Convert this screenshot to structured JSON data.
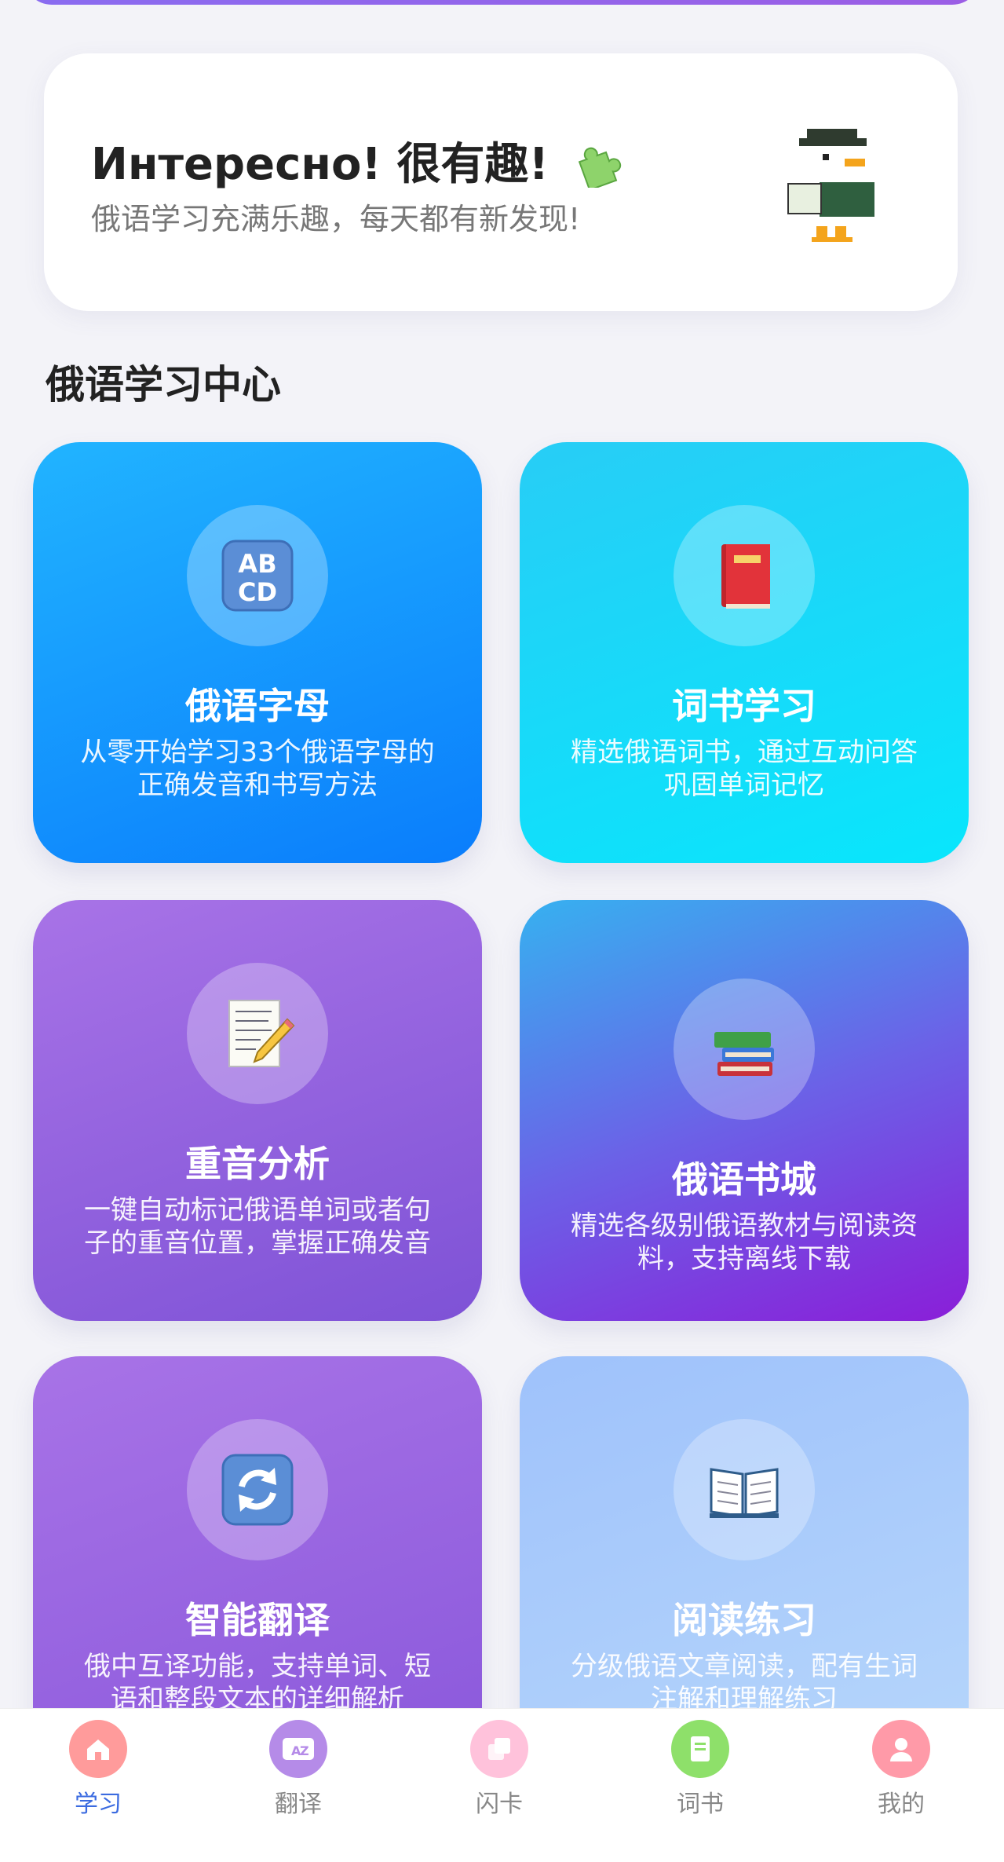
{
  "banner": {
    "title": "Интересно! 很有趣!",
    "subtitle": "俄语学习充满乐趣，每天都有新发现!"
  },
  "section": {
    "title": "俄语学习中心"
  },
  "cards": [
    {
      "title": "俄语字母",
      "desc": "从零开始学习33个俄语字母的正确发音和书写方法",
      "icon": "abcd-icon"
    },
    {
      "title": "词书学习",
      "desc": "精选俄语词书，通过互动问答巩固单词记忆",
      "icon": "red-book-icon"
    },
    {
      "title": "重音分析",
      "desc": "一键自动标记俄语单词或者句子的重音位置，掌握正确发音",
      "icon": "memo-pencil-icon"
    },
    {
      "title": "俄语书城",
      "desc": "精选各级别俄语教材与阅读资料，支持离线下载",
      "icon": "books-stack-icon"
    },
    {
      "title": "智能翻译",
      "desc": "俄中互译功能，支持单词、短语和整段文本的详细解析",
      "icon": "refresh-icon"
    },
    {
      "title": "阅读练习",
      "desc": "分级俄语文章阅读，配有生词注解和理解练习",
      "icon": "open-book-icon"
    }
  ],
  "tabs": [
    {
      "label": "学习",
      "icon": "home-icon",
      "active": true
    },
    {
      "label": "翻译",
      "icon": "translate-icon",
      "active": false
    },
    {
      "label": "闪卡",
      "icon": "flashcard-icon",
      "active": false
    },
    {
      "label": "词书",
      "icon": "wordbook-icon",
      "active": false
    },
    {
      "label": "我的",
      "icon": "profile-icon",
      "active": false
    }
  ],
  "colors": {
    "accent": "#3b6be0",
    "tab_home": "#ff8f8f",
    "tab_translate": "#b58be8",
    "tab_flashcard": "#ffb3d1",
    "tab_wordbook": "#8ee06a",
    "tab_profile": "#ff9aa8"
  }
}
